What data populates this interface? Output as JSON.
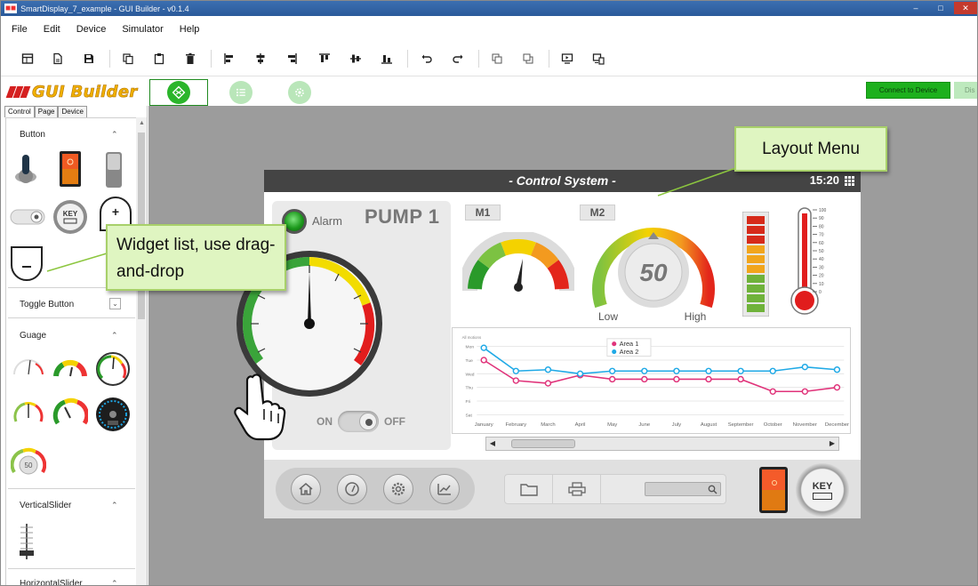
{
  "window": {
    "title": "SmartDisplay_7_example - GUI Builder - v0.1.4",
    "brand_mark": "■■"
  },
  "menu": [
    "File",
    "Edit",
    "Device",
    "Simulator",
    "Help"
  ],
  "toolbar": {
    "icons": [
      "new-layout-icon",
      "new-file-icon",
      "save-icon",
      "copy-icon",
      "paste-icon",
      "delete-icon",
      "align-left-icon",
      "align-center-icon",
      "align-right-icon",
      "align-top-icon",
      "align-middle-icon",
      "align-bottom-icon",
      "undo-icon",
      "redo-icon",
      "bring-front-icon",
      "send-back-icon",
      "preview-icon",
      "deploy-icon"
    ]
  },
  "header": {
    "brand": "GUI Builder",
    "connect_label": "Connect to Device",
    "disconnect_label": "Dis"
  },
  "left_panel": {
    "tabs": [
      "Control",
      "Page",
      "Device"
    ],
    "sections": [
      {
        "label": "Button",
        "state": "expanded"
      },
      {
        "label": "Toggle Button",
        "state": "collapsed"
      },
      {
        "label": "Guage",
        "state": "expanded"
      },
      {
        "label": "VerticalSlider",
        "state": "expanded"
      },
      {
        "label": "HorizontalSlider",
        "state": "expanded"
      }
    ],
    "button_widgets": [
      "toggle-lever-widget",
      "rocker-switch-widget",
      "slide-switch-widget",
      "toggle-switch-widget",
      "key-button-widget",
      "plus-button-widget",
      "minus-button-widget"
    ],
    "key_text": "KEY",
    "gauge_value": "50"
  },
  "device": {
    "title": "- Control System -",
    "clock": "15:20",
    "alarm_label": "Alarm",
    "pump_label": "PUMP 1",
    "switch_on": "ON",
    "switch_off": "OFF",
    "m1": "M1",
    "m2": "M2",
    "gauge_value": "50",
    "gauge_low": "Low",
    "gauge_high": "High",
    "thermo_ticks": [
      "100",
      "90",
      "80",
      "70",
      "60",
      "50",
      "40",
      "30",
      "20",
      "10",
      "0"
    ],
    "key_label": "KEY"
  },
  "chart_data": {
    "type": "line",
    "title": "All motions",
    "categories": [
      "January",
      "February",
      "March",
      "April",
      "May",
      "June",
      "July",
      "August",
      "September",
      "October",
      "November",
      "December"
    ],
    "y_categories": [
      "Mon",
      "Tue",
      "Wed",
      "Thu",
      "Fri",
      "Sat"
    ],
    "series": [
      {
        "name": "Area 1",
        "color": "#e0337a",
        "values": [
          1,
          2.5,
          2.7,
          2.1,
          2.4,
          2.4,
          2.4,
          2.4,
          2.4,
          3.3,
          3.3,
          3.0
        ]
      },
      {
        "name": "Area 2",
        "color": "#1fa9e6",
        "values": [
          0.1,
          1.8,
          1.7,
          2.0,
          1.8,
          1.8,
          1.8,
          1.8,
          1.8,
          1.8,
          1.5,
          1.7
        ]
      }
    ],
    "legend": "top-center",
    "grid": true
  },
  "callouts": {
    "widgets": "Widget list, use drag-and-drop",
    "layout": "Layout Menu"
  }
}
